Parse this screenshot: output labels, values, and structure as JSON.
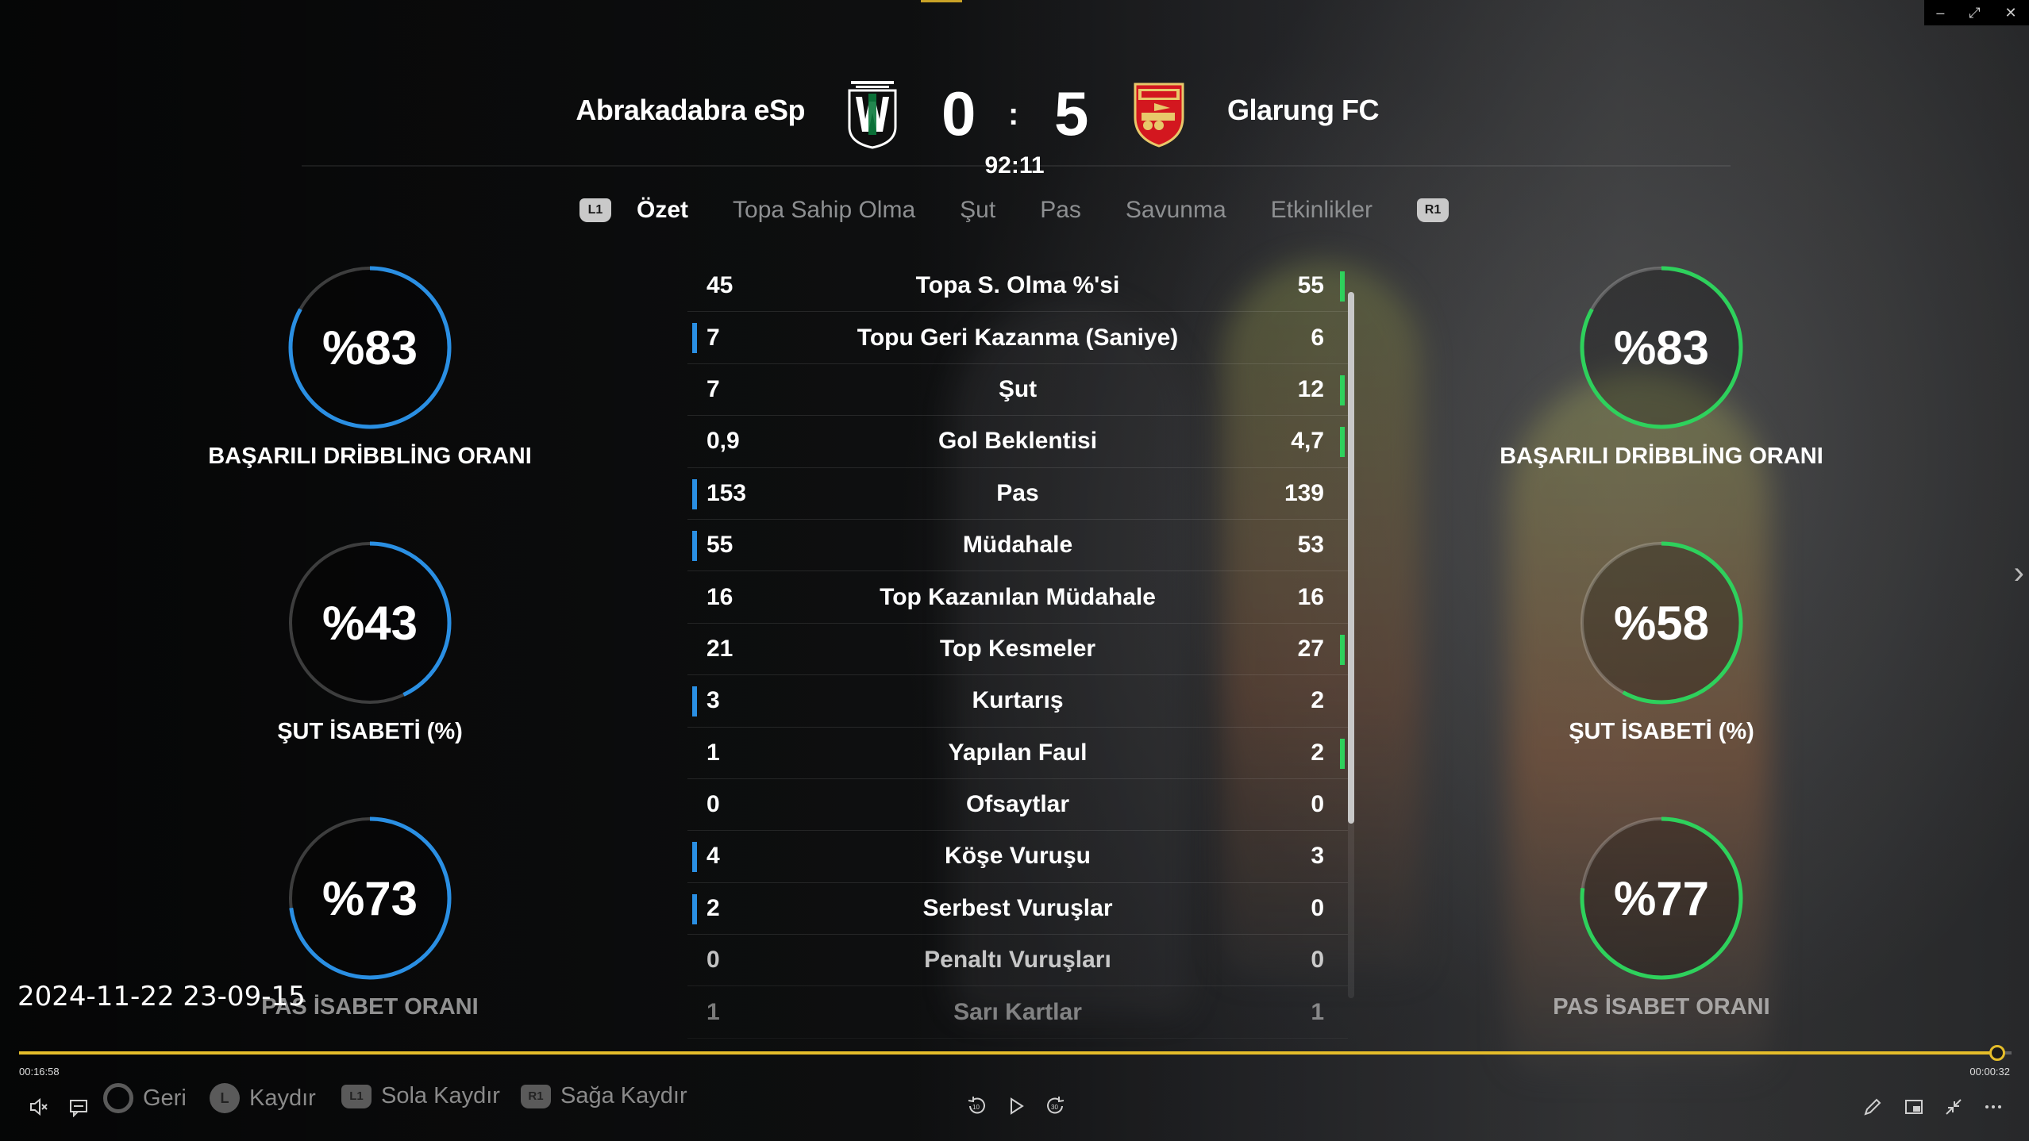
{
  "match": {
    "home_team": "Abrakadabra eSp",
    "away_team": "Glarung FC",
    "home_score": "0",
    "away_score": "5",
    "separator": ":",
    "clock": "92:11"
  },
  "tabs": {
    "prev_button": "L1",
    "next_button": "R1",
    "items": [
      "Özet",
      "Topa Sahip Olma",
      "Şut",
      "Pas",
      "Savunma",
      "Etkinlikler"
    ],
    "active": "Özet"
  },
  "stats": [
    {
      "label": "Topa S. Olma %'si",
      "home": "45",
      "away": "55",
      "leader": "away"
    },
    {
      "label": "Topu Geri Kazanma (Saniye)",
      "home": "7",
      "away": "6",
      "leader": "home"
    },
    {
      "label": "Şut",
      "home": "7",
      "away": "12",
      "leader": "away"
    },
    {
      "label": "Gol Beklentisi",
      "home": "0,9",
      "away": "4,7",
      "leader": "away"
    },
    {
      "label": "Pas",
      "home": "153",
      "away": "139",
      "leader": "home"
    },
    {
      "label": "Müdahale",
      "home": "55",
      "away": "53",
      "leader": "home"
    },
    {
      "label": "Top Kazanılan Müdahale",
      "home": "16",
      "away": "16",
      "leader": "none"
    },
    {
      "label": "Top Kesmeler",
      "home": "21",
      "away": "27",
      "leader": "away"
    },
    {
      "label": "Kurtarış",
      "home": "3",
      "away": "2",
      "leader": "home"
    },
    {
      "label": "Yapılan Faul",
      "home": "1",
      "away": "2",
      "leader": "away"
    },
    {
      "label": "Ofsaytlar",
      "home": "0",
      "away": "0",
      "leader": "none"
    },
    {
      "label": "Köşe Vuruşu",
      "home": "4",
      "away": "3",
      "leader": "home"
    },
    {
      "label": "Serbest Vuruşlar",
      "home": "2",
      "away": "0",
      "leader": "home"
    },
    {
      "label": "Penaltı Vuruşları",
      "home": "0",
      "away": "0",
      "leader": "none"
    },
    {
      "label": "Sarı Kartlar",
      "home": "1",
      "away": "1",
      "leader": "none"
    }
  ],
  "home_rings": [
    {
      "pct": "%83",
      "value": 0.83,
      "label": "BAŞARILI DRİBBLİNG ORANI"
    },
    {
      "pct": "%43",
      "value": 0.43,
      "label": "ŞUT İSABETİ (%)"
    },
    {
      "pct": "%73",
      "value": 0.73,
      "label": "PAS İSABET ORANI"
    }
  ],
  "away_rings": [
    {
      "pct": "%83",
      "value": 0.83,
      "label": "BAŞARILI DRİBBLİNG ORANI"
    },
    {
      "pct": "%58",
      "value": 0.58,
      "label": "ŞUT İSABETİ (%)"
    },
    {
      "pct": "%77",
      "value": 0.77,
      "label": "PAS İSABET ORANI"
    }
  ],
  "colors": {
    "home": "#2a8fe3",
    "away": "#2ed15c",
    "progress": "#e5bd2a"
  },
  "player": {
    "timestamp_overlay": "2024-11-22 23-09-15",
    "elapsed": "00:16:58",
    "remaining": "00:00:32",
    "progress": 0.993,
    "hints": {
      "back": "Geri",
      "scroll": "Kaydır",
      "scroll_left": "Sola Kaydır",
      "scroll_right": "Sağa Kaydır",
      "scroll_left_chip": "L1",
      "scroll_right_chip": "R1",
      "stick_chip": "L"
    },
    "icons": [
      "mute-icon",
      "subtitles-icon",
      "rewind-10-icon",
      "play-icon",
      "forward-30-icon",
      "edit-icon",
      "miniplayer-icon",
      "exit-fullscreen-icon",
      "more-icon"
    ]
  }
}
